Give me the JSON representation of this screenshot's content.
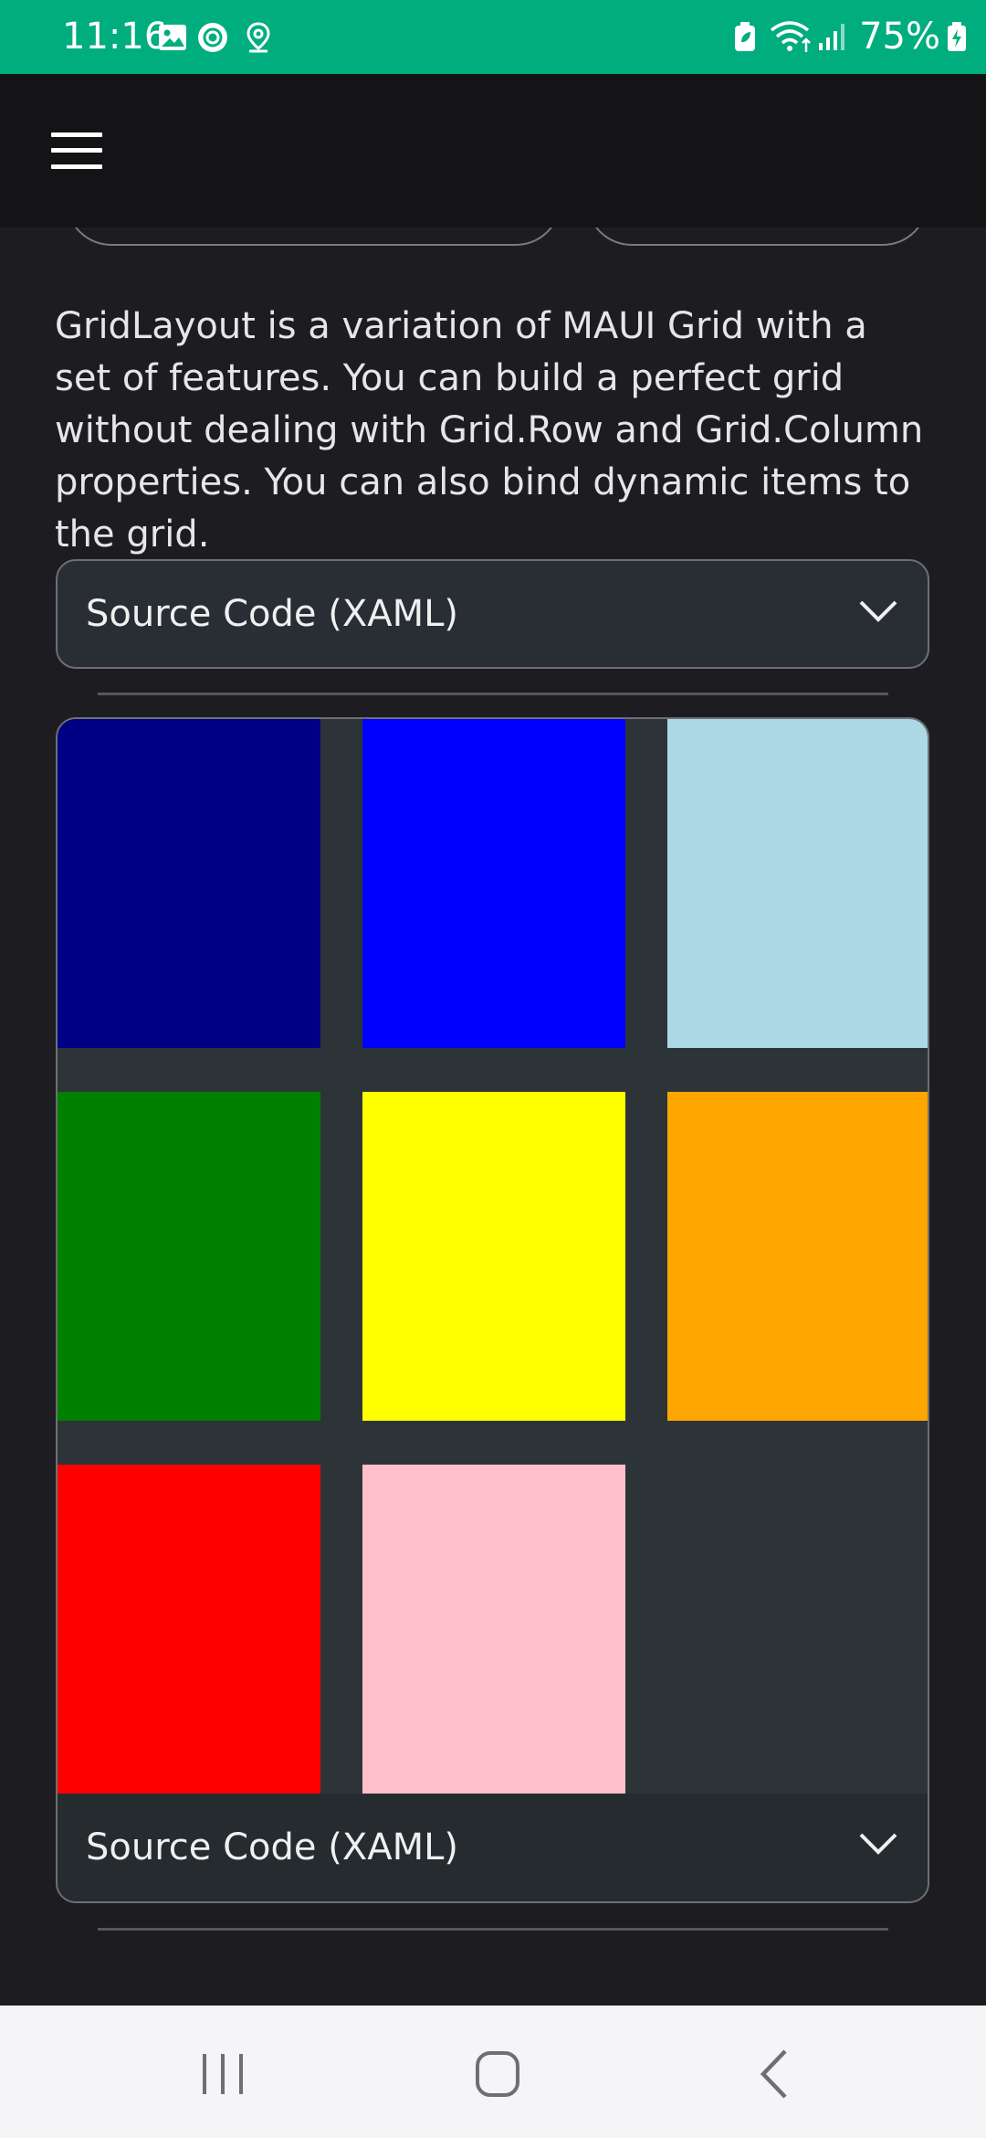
{
  "status_bar": {
    "time": "11:16",
    "battery": "75%",
    "left_icons": [
      "image-icon",
      "record-icon",
      "location-icon"
    ],
    "right_icons": [
      "battery-saver-icon",
      "wifi-icon",
      "signal-icon",
      "battery-charging-icon"
    ]
  },
  "app_bar": {
    "menu_icon": "hamburger-icon"
  },
  "main": {
    "description": "GridLayout is a variation of MAUI Grid with a set of features. You can build a perfect grid without dealing with Grid.Row and Grid.Column properties. You can also bind dynamic items to the grid.",
    "source_expander_label": "Source Code (XAML)",
    "grid_items": [
      {
        "color": "#000085"
      },
      {
        "color": "#0000ff"
      },
      {
        "color": "#add8e6"
      },
      {
        "color": "#008000"
      },
      {
        "color": "#ffff00"
      },
      {
        "color": "#ffa500"
      },
      {
        "color": "#ff0000"
      },
      {
        "color": "#ffc0cb"
      }
    ],
    "grid_footer_label": "Source Code (XAML)"
  },
  "colors": {
    "status_bar": "#00ad7e",
    "app_bar": "#141416",
    "background": "#1d1d21",
    "expander_bg": "#282e33",
    "grid_bg": "#2d3437"
  },
  "nav_bar": {
    "buttons": [
      "recent-apps-icon",
      "home-icon",
      "back-icon"
    ]
  }
}
